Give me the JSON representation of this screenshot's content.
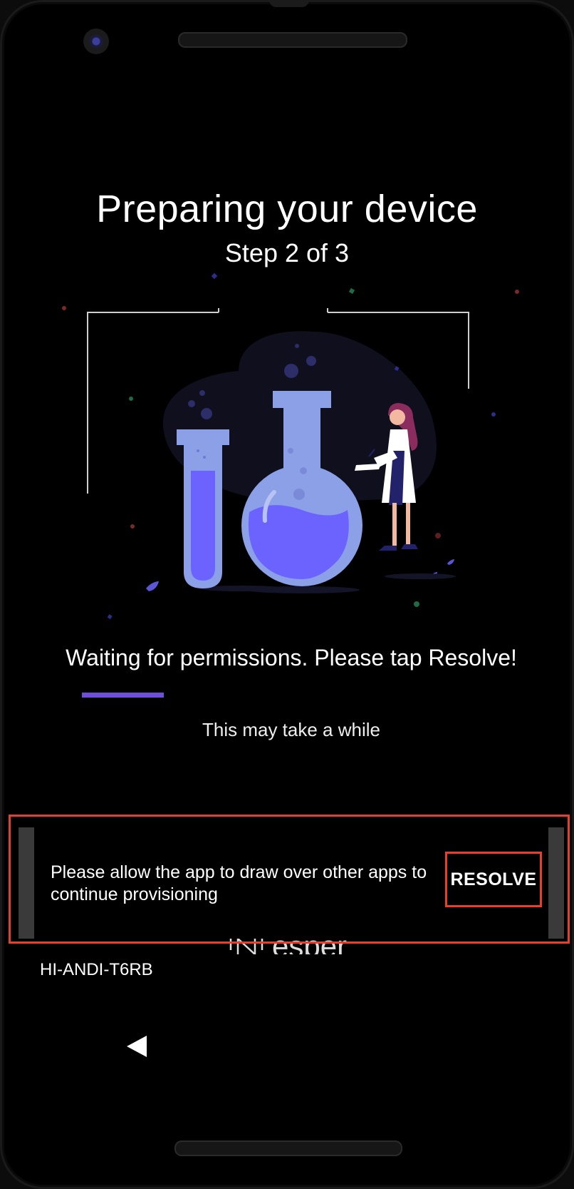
{
  "header": {
    "title": "Preparing your device",
    "step": "Step 2 of 3"
  },
  "status": {
    "message": "Waiting for permissions. Please tap Resolve!",
    "note": "This may take a while",
    "progress": 0.2
  },
  "snackbar": {
    "message": "Please allow the app to draw over other apps to continue provisioning",
    "action_label": "RESOLVE"
  },
  "brand": {
    "name": "esper"
  },
  "device": {
    "id": "HI-ANDI-T6RB"
  },
  "icons": {
    "back": "back-arrow-icon",
    "logo": "esper-logo-icon",
    "camera": "front-camera-icon"
  },
  "colors": {
    "accent": "#6f4fd8",
    "highlight": "#e2412e",
    "flask": "#8ba0e6",
    "liquid": "#6c63ff",
    "background": "#000000"
  }
}
